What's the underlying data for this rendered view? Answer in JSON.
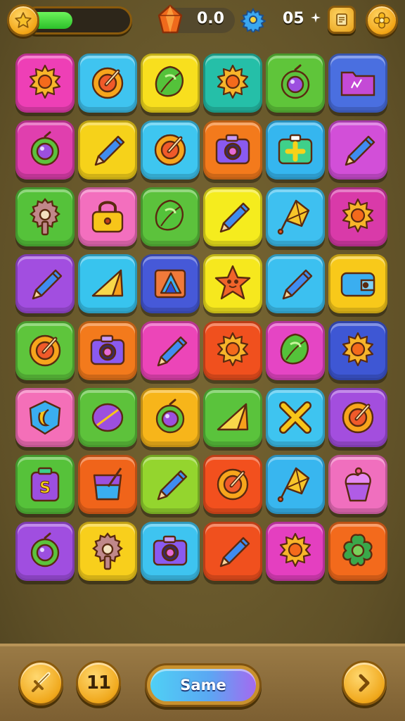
{
  "hud": {
    "energy_fill_fraction": 0.45,
    "energy_color": "#2cc02a",
    "currency_value": "0.0",
    "level_value": "05",
    "left_icon": "star-icon",
    "gem_icon": "orange-gem-icon",
    "gear_icon": "gear-icon",
    "scroll_icon": "scroll-icon",
    "right_icon": "flower-icon"
  },
  "grid": {
    "rows": 8,
    "cols": 6,
    "tiles": [
      {
        "color": "#ee3fb6",
        "icon": "sun"
      },
      {
        "color": "#3fc4f0",
        "icon": "target"
      },
      {
        "color": "#f8df1e",
        "icon": "leaf"
      },
      {
        "color": "#25bfa8",
        "icon": "sun"
      },
      {
        "color": "#5fc53a",
        "icon": "ring"
      },
      {
        "color": "#4a6fe0",
        "icon": "folder"
      },
      {
        "color": "#e03fae",
        "icon": "ring"
      },
      {
        "color": "#f6d21a",
        "icon": "pencil"
      },
      {
        "color": "#3ec6f0",
        "icon": "target"
      },
      {
        "color": "#f37a1c",
        "icon": "camera"
      },
      {
        "color": "#35b6ef",
        "icon": "medkit"
      },
      {
        "color": "#d24fd8",
        "icon": "pencil"
      },
      {
        "color": "#55c23a",
        "icon": "gear"
      },
      {
        "color": "#f36fbe",
        "icon": "lock"
      },
      {
        "color": "#5cc23c",
        "icon": "leaf"
      },
      {
        "color": "#f5ec1e",
        "icon": "pencil"
      },
      {
        "color": "#3ec0f0",
        "icon": "kite"
      },
      {
        "color": "#d93aa9",
        "icon": "sun"
      },
      {
        "color": "#a24ee0",
        "icon": "pencil"
      },
      {
        "color": "#38c4ee",
        "icon": "wedge"
      },
      {
        "color": "#4659d8",
        "icon": "triangle"
      },
      {
        "color": "#f6e81e",
        "icon": "star"
      },
      {
        "color": "#3cc0f0",
        "icon": "pencil"
      },
      {
        "color": "#f8c91a",
        "icon": "wallet"
      },
      {
        "color": "#5ec53c",
        "icon": "target"
      },
      {
        "color": "#f37a1c",
        "icon": "camera"
      },
      {
        "color": "#ec45b8",
        "icon": "pencil"
      },
      {
        "color": "#f0501e",
        "icon": "sun"
      },
      {
        "color": "#e545c4",
        "icon": "leaf"
      },
      {
        "color": "#3e57d4",
        "icon": "sun"
      },
      {
        "color": "#f46fb8",
        "icon": "moon"
      },
      {
        "color": "#5dc23b",
        "icon": "oval"
      },
      {
        "color": "#f7b51a",
        "icon": "ring"
      },
      {
        "color": "#5ac33c",
        "icon": "wedge"
      },
      {
        "color": "#3ec4f0",
        "icon": "cross"
      },
      {
        "color": "#a34ede",
        "icon": "target"
      },
      {
        "color": "#56c23a",
        "icon": "bag"
      },
      {
        "color": "#f0641a",
        "icon": "cup"
      },
      {
        "color": "#94d52e",
        "icon": "pencil"
      },
      {
        "color": "#f2501e",
        "icon": "target"
      },
      {
        "color": "#38b6ef",
        "icon": "kite"
      },
      {
        "color": "#f06fbe",
        "icon": "cupcake"
      },
      {
        "color": "#a04ee0",
        "icon": "ring"
      },
      {
        "color": "#f8cf1c",
        "icon": "gear"
      },
      {
        "color": "#3ec4f0",
        "icon": "camera"
      },
      {
        "color": "#f0501e",
        "icon": "pencil"
      },
      {
        "color": "#e43fc0",
        "icon": "sun"
      },
      {
        "color": "#f36a1c",
        "icon": "flower"
      }
    ]
  },
  "bottom_bar": {
    "left_icon": "sword-icon",
    "pause_label": "11",
    "main_button_label": "Same",
    "main_button_gradient_start": "#4fd0f5",
    "main_button_gradient_end": "#a46af0",
    "next_icon": "chevron-right-icon"
  }
}
